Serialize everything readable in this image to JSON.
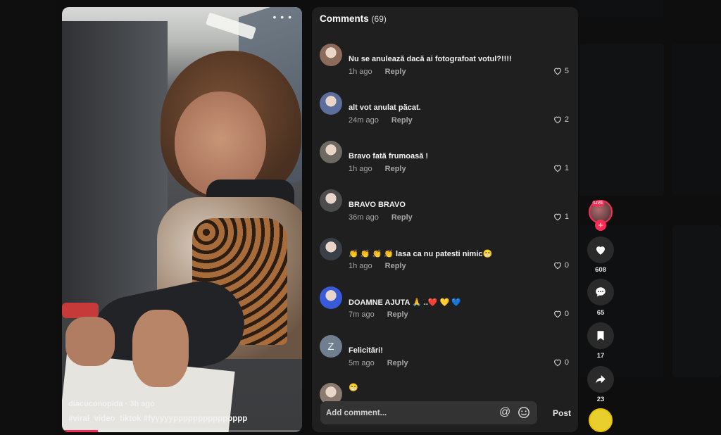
{
  "video": {
    "author_line": "diacuconopida · 3h ago",
    "hashtags": "#viral_video_tiktok  #fyyyyyppppppppppppppp",
    "progress_fraction": 0.15
  },
  "comments_panel": {
    "title": "Comments",
    "count_text": "(69)",
    "reply_label": "Reply",
    "comments": [
      {
        "text": "Nu se anulează dacă ai fotografoat votul?!!!!",
        "time": "1h ago",
        "likes": "5",
        "avatar_color": "#8c6b5a"
      },
      {
        "text": "alt vot anulat păcat.",
        "time": "24m ago",
        "likes": "2",
        "avatar_color": "#5c6f9c"
      },
      {
        "text": "Bravo fată frumoasă !",
        "time": "1h ago",
        "likes": "1",
        "avatar_color": "#6e6a63"
      },
      {
        "text": "BRAVO BRAVO",
        "time": "36m ago",
        "likes": "1",
        "avatar_color": "#4c4c4c"
      },
      {
        "text": "👏 👏 👏 👏 lasa ca nu patesti nimic😁",
        "time": "1h ago",
        "likes": "0",
        "avatar_color": "#3b4048"
      },
      {
        "text": "DOAMNE AJUTA 🙏 ..❤️ 💛 💙",
        "time": "7m ago",
        "likes": "0",
        "avatar_color": "#3a5bd9"
      },
      {
        "text": "Felicitări!",
        "time": "5m ago",
        "likes": "0",
        "avatar_color": "#6f7f8f",
        "avatar_letter": "Z"
      },
      {
        "text": "😁",
        "time": "",
        "likes": "",
        "avatar_color": "#8a7a70"
      }
    ],
    "composer_placeholder": "Add comment...",
    "at_symbol": "@",
    "post_label": "Post"
  },
  "rail": {
    "live_label": "LIVE",
    "likes": "608",
    "comments": "65",
    "saves": "17",
    "shares": "23"
  },
  "colors": {
    "accent": "#fe2c55",
    "panel": "#1f1f1f"
  }
}
